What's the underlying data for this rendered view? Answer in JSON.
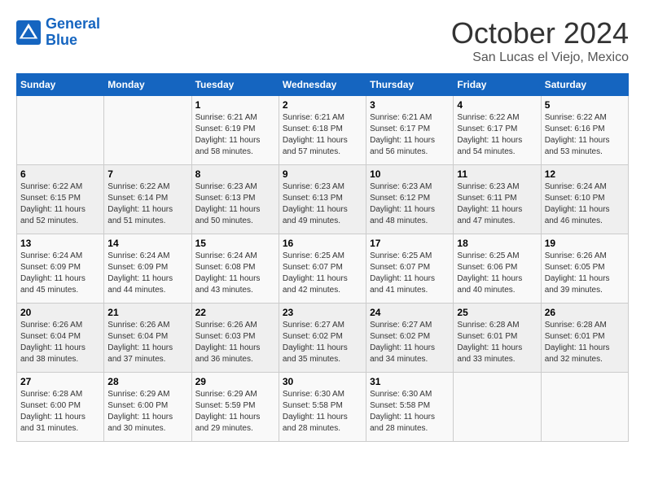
{
  "logo": {
    "line1": "General",
    "line2": "Blue"
  },
  "title": "October 2024",
  "subtitle": "San Lucas el Viejo, Mexico",
  "weekdays": [
    "Sunday",
    "Monday",
    "Tuesday",
    "Wednesday",
    "Thursday",
    "Friday",
    "Saturday"
  ],
  "weeks": [
    [
      {
        "day": "",
        "sunrise": "",
        "sunset": "",
        "daylight": ""
      },
      {
        "day": "",
        "sunrise": "",
        "sunset": "",
        "daylight": ""
      },
      {
        "day": "1",
        "sunrise": "Sunrise: 6:21 AM",
        "sunset": "Sunset: 6:19 PM",
        "daylight": "Daylight: 11 hours and 58 minutes."
      },
      {
        "day": "2",
        "sunrise": "Sunrise: 6:21 AM",
        "sunset": "Sunset: 6:18 PM",
        "daylight": "Daylight: 11 hours and 57 minutes."
      },
      {
        "day": "3",
        "sunrise": "Sunrise: 6:21 AM",
        "sunset": "Sunset: 6:17 PM",
        "daylight": "Daylight: 11 hours and 56 minutes."
      },
      {
        "day": "4",
        "sunrise": "Sunrise: 6:22 AM",
        "sunset": "Sunset: 6:17 PM",
        "daylight": "Daylight: 11 hours and 54 minutes."
      },
      {
        "day": "5",
        "sunrise": "Sunrise: 6:22 AM",
        "sunset": "Sunset: 6:16 PM",
        "daylight": "Daylight: 11 hours and 53 minutes."
      }
    ],
    [
      {
        "day": "6",
        "sunrise": "Sunrise: 6:22 AM",
        "sunset": "Sunset: 6:15 PM",
        "daylight": "Daylight: 11 hours and 52 minutes."
      },
      {
        "day": "7",
        "sunrise": "Sunrise: 6:22 AM",
        "sunset": "Sunset: 6:14 PM",
        "daylight": "Daylight: 11 hours and 51 minutes."
      },
      {
        "day": "8",
        "sunrise": "Sunrise: 6:23 AM",
        "sunset": "Sunset: 6:13 PM",
        "daylight": "Daylight: 11 hours and 50 minutes."
      },
      {
        "day": "9",
        "sunrise": "Sunrise: 6:23 AM",
        "sunset": "Sunset: 6:13 PM",
        "daylight": "Daylight: 11 hours and 49 minutes."
      },
      {
        "day": "10",
        "sunrise": "Sunrise: 6:23 AM",
        "sunset": "Sunset: 6:12 PM",
        "daylight": "Daylight: 11 hours and 48 minutes."
      },
      {
        "day": "11",
        "sunrise": "Sunrise: 6:23 AM",
        "sunset": "Sunset: 6:11 PM",
        "daylight": "Daylight: 11 hours and 47 minutes."
      },
      {
        "day": "12",
        "sunrise": "Sunrise: 6:24 AM",
        "sunset": "Sunset: 6:10 PM",
        "daylight": "Daylight: 11 hours and 46 minutes."
      }
    ],
    [
      {
        "day": "13",
        "sunrise": "Sunrise: 6:24 AM",
        "sunset": "Sunset: 6:09 PM",
        "daylight": "Daylight: 11 hours and 45 minutes."
      },
      {
        "day": "14",
        "sunrise": "Sunrise: 6:24 AM",
        "sunset": "Sunset: 6:09 PM",
        "daylight": "Daylight: 11 hours and 44 minutes."
      },
      {
        "day": "15",
        "sunrise": "Sunrise: 6:24 AM",
        "sunset": "Sunset: 6:08 PM",
        "daylight": "Daylight: 11 hours and 43 minutes."
      },
      {
        "day": "16",
        "sunrise": "Sunrise: 6:25 AM",
        "sunset": "Sunset: 6:07 PM",
        "daylight": "Daylight: 11 hours and 42 minutes."
      },
      {
        "day": "17",
        "sunrise": "Sunrise: 6:25 AM",
        "sunset": "Sunset: 6:07 PM",
        "daylight": "Daylight: 11 hours and 41 minutes."
      },
      {
        "day": "18",
        "sunrise": "Sunrise: 6:25 AM",
        "sunset": "Sunset: 6:06 PM",
        "daylight": "Daylight: 11 hours and 40 minutes."
      },
      {
        "day": "19",
        "sunrise": "Sunrise: 6:26 AM",
        "sunset": "Sunset: 6:05 PM",
        "daylight": "Daylight: 11 hours and 39 minutes."
      }
    ],
    [
      {
        "day": "20",
        "sunrise": "Sunrise: 6:26 AM",
        "sunset": "Sunset: 6:04 PM",
        "daylight": "Daylight: 11 hours and 38 minutes."
      },
      {
        "day": "21",
        "sunrise": "Sunrise: 6:26 AM",
        "sunset": "Sunset: 6:04 PM",
        "daylight": "Daylight: 11 hours and 37 minutes."
      },
      {
        "day": "22",
        "sunrise": "Sunrise: 6:26 AM",
        "sunset": "Sunset: 6:03 PM",
        "daylight": "Daylight: 11 hours and 36 minutes."
      },
      {
        "day": "23",
        "sunrise": "Sunrise: 6:27 AM",
        "sunset": "Sunset: 6:02 PM",
        "daylight": "Daylight: 11 hours and 35 minutes."
      },
      {
        "day": "24",
        "sunrise": "Sunrise: 6:27 AM",
        "sunset": "Sunset: 6:02 PM",
        "daylight": "Daylight: 11 hours and 34 minutes."
      },
      {
        "day": "25",
        "sunrise": "Sunrise: 6:28 AM",
        "sunset": "Sunset: 6:01 PM",
        "daylight": "Daylight: 11 hours and 33 minutes."
      },
      {
        "day": "26",
        "sunrise": "Sunrise: 6:28 AM",
        "sunset": "Sunset: 6:01 PM",
        "daylight": "Daylight: 11 hours and 32 minutes."
      }
    ],
    [
      {
        "day": "27",
        "sunrise": "Sunrise: 6:28 AM",
        "sunset": "Sunset: 6:00 PM",
        "daylight": "Daylight: 11 hours and 31 minutes."
      },
      {
        "day": "28",
        "sunrise": "Sunrise: 6:29 AM",
        "sunset": "Sunset: 6:00 PM",
        "daylight": "Daylight: 11 hours and 30 minutes."
      },
      {
        "day": "29",
        "sunrise": "Sunrise: 6:29 AM",
        "sunset": "Sunset: 5:59 PM",
        "daylight": "Daylight: 11 hours and 29 minutes."
      },
      {
        "day": "30",
        "sunrise": "Sunrise: 6:30 AM",
        "sunset": "Sunset: 5:58 PM",
        "daylight": "Daylight: 11 hours and 28 minutes."
      },
      {
        "day": "31",
        "sunrise": "Sunrise: 6:30 AM",
        "sunset": "Sunset: 5:58 PM",
        "daylight": "Daylight: 11 hours and 28 minutes."
      },
      {
        "day": "",
        "sunrise": "",
        "sunset": "",
        "daylight": ""
      },
      {
        "day": "",
        "sunrise": "",
        "sunset": "",
        "daylight": ""
      }
    ]
  ]
}
